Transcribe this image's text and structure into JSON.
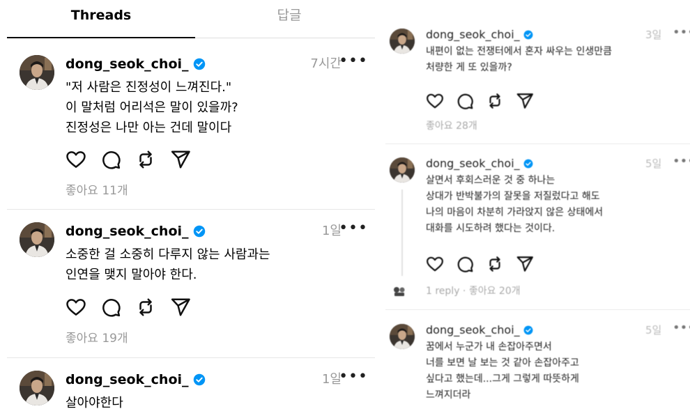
{
  "tabs": {
    "threads": "Threads",
    "replies": "답글"
  },
  "left_posts": [
    {
      "user": "dong_seok_choi_",
      "time": "7시간",
      "text": "\"저 사람은 진정성이 느껴진다.\"\n이 말처럼 어리석은 말이 있을까?\n진정성은 나만 아는 건데 말이다",
      "likes": "좋아요 11개"
    },
    {
      "user": "dong_seok_choi_",
      "time": "1일",
      "text": "소중한 걸 소중히 다루지 않는 사람과는\n인연을 맺지 말아야 한다.",
      "likes": "좋아요 19개"
    },
    {
      "user": "dong_seok_choi_",
      "time": "1일",
      "text": "살아야한다"
    }
  ],
  "right_posts": [
    {
      "user": "dong_seok_choi_",
      "time": "3일",
      "text": "내편이 없는 전쟁터에서 혼자 싸우는 인생만큼\n처량한 게 또 있을까?",
      "likes": "좋아요 28개"
    },
    {
      "user": "dong_seok_choi_",
      "time": "5일",
      "text": "살면서 후회스러운 것 중 하나는\n상대가 반박불가의 잘못을 저질렀다고 해도\n나의 마음이 차분히 가라앉지 않은 상태에서\n대화를 시도하려 했다는 것이다.",
      "likes": "1 reply · 좋아요 20개"
    },
    {
      "user": "dong_seok_choi_",
      "time": "5일",
      "text": "꿈에서 누군가 내 손잡아주면서\n너를 보면 날 보는 것 같아 손잡아주고\n싶다고 했는데...그게 그렇게 따뜻하게\n느껴지더라"
    }
  ],
  "more_glyph": "•••",
  "accent_color": "#0095f6",
  "icons": [
    "heart-icon",
    "comment-icon",
    "repost-icon",
    "share-icon",
    "verified-icon",
    "more-icon"
  ]
}
